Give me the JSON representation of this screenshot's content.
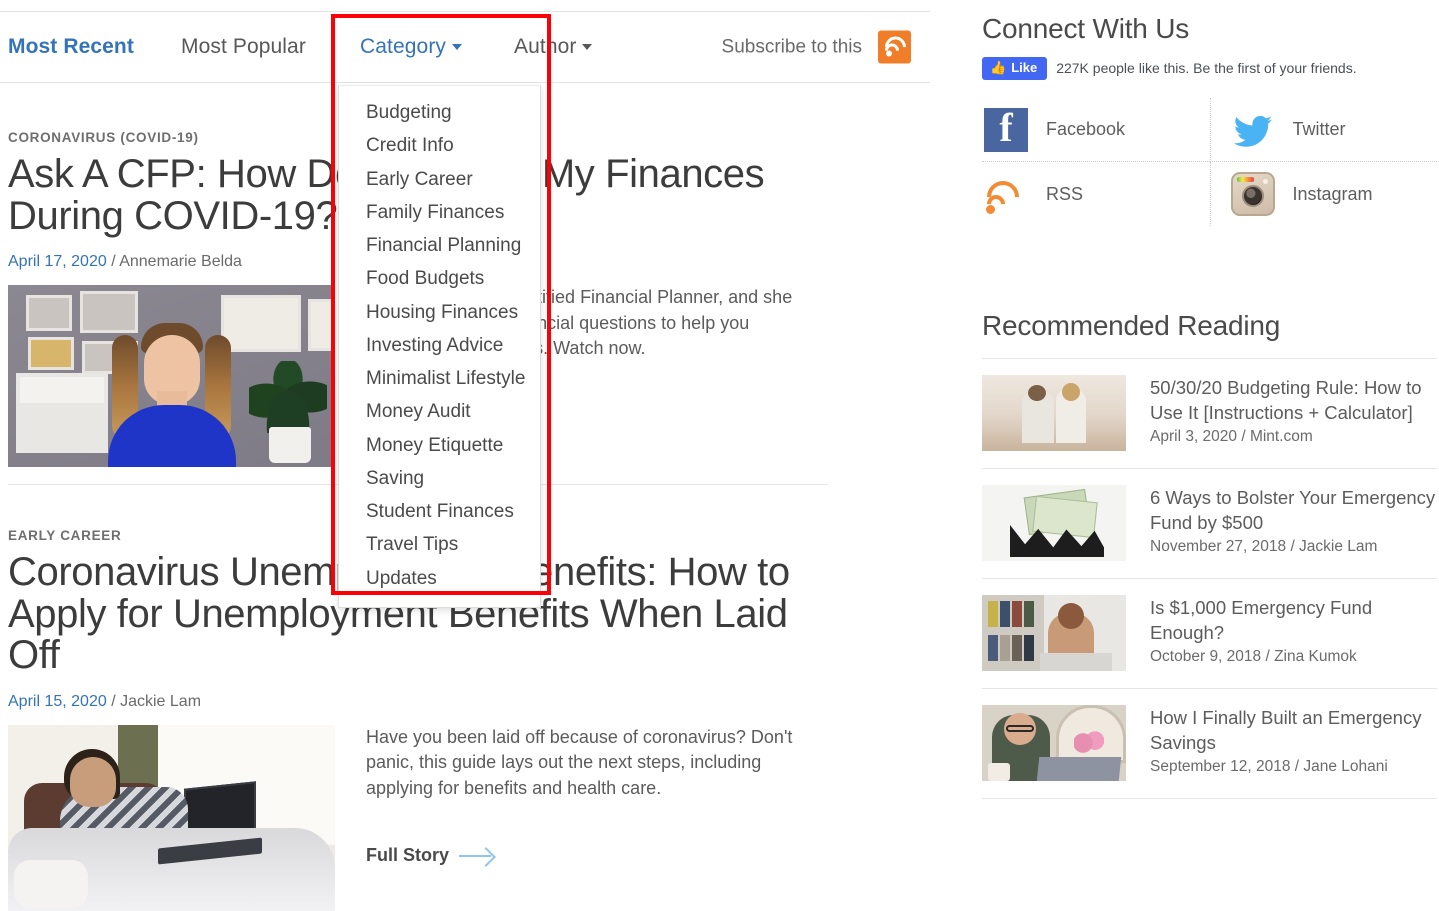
{
  "nav": {
    "items": [
      {
        "label": "Most Recent",
        "active": true,
        "has_caret": false
      },
      {
        "label": "Most Popular",
        "active": false,
        "has_caret": false
      },
      {
        "label": "Category",
        "active": false,
        "has_caret": true
      },
      {
        "label": "Author",
        "active": false,
        "has_caret": true
      }
    ],
    "subscribe_label": "Subscribe to this",
    "rss_icon": "rss-icon"
  },
  "category_dropdown": {
    "open": true,
    "items": [
      "Budgeting",
      "Credit Info",
      "Early Career",
      "Family Finances",
      "Financial Planning",
      "Food Budgets",
      "Housing Finances",
      "Investing Advice",
      "Minimalist Lifestyle",
      "Money Audit",
      "Money Etiquette",
      "Saving",
      "Student Finances",
      "Travel Tips",
      "Updates"
    ]
  },
  "annotation": {
    "shape": "rectangle",
    "color": "#fc0006"
  },
  "articles": [
    {
      "kicker": "CORONAVIRUS (COVID-19)",
      "headline": "Ask A CFP: How Do I Manage My Finances During COVID-19?",
      "date": "April 17, 2020",
      "separator": "/",
      "author": "Annemarie Belda",
      "excerpt": "Brittney Castro is Certified Financial Planner, and she answers your top financial questions to help you manage your finances. Watch now.",
      "image_alt": "Woman in blue top in home office with framed certificates"
    },
    {
      "kicker": "EARLY CAREER",
      "headline": "Coronavirus Unemployment Benefits: How to Apply for Unemployment Benefits When Laid Off",
      "date": "April 15, 2020",
      "separator": "/",
      "author": "Jackie Lam",
      "excerpt": "Have you been laid off because of coronavirus? Don't panic, this guide lays out the next steps, including applying for benefits and health care.",
      "cta": "Full Story",
      "image_alt": "Woman on bed using a laptop"
    }
  ],
  "sidebar": {
    "connect": {
      "title": "Connect With Us",
      "fb_like_label": "Like",
      "fb_like_count_text": "227K people like this. Be the first of your friends.",
      "social": [
        {
          "label": "Facebook",
          "icon": "facebook-icon"
        },
        {
          "label": "Twitter",
          "icon": "twitter-icon"
        },
        {
          "label": "RSS",
          "icon": "rss-icon"
        },
        {
          "label": "Instagram",
          "icon": "instagram-icon"
        }
      ]
    },
    "recommended": {
      "title": "Recommended Reading",
      "items": [
        {
          "headline": "50/30/20 Budgeting Rule: How to Use It [Instructions + Calculator]",
          "date": "April 3, 2020",
          "separator": "/",
          "author": "Mint.com",
          "meta": "April 3, 2020 / Mint.com",
          "image_alt": "Couple sitting on floor"
        },
        {
          "headline": "6 Ways to Bolster Your Emergency Fund by $500",
          "date": "November 27, 2018",
          "separator": "/",
          "author": "Jackie Lam",
          "meta": "November 27, 2018 / Jackie Lam",
          "image_alt": "Folded dollar bills casting a shadow"
        },
        {
          "headline": "Is $1,000 Emergency Fund Enough?",
          "date": "October 9, 2018",
          "separator": "/",
          "author": "Zina Kumok",
          "meta": "October 9, 2018 / Zina Kumok",
          "image_alt": "Woman at desk with laptop and bookshelf"
        },
        {
          "headline": "How I Finally Built an Emergency Savings",
          "date": "September 12, 2018",
          "separator": "/",
          "author": "Jane Lohani",
          "meta": "September 12, 2018 / Jane Lohani",
          "image_alt": "Woman with glasses looking at laptop"
        }
      ]
    }
  },
  "colors": {
    "link_blue": "#3573b9",
    "rss_orange": "#f07d28",
    "facebook_blue": "#4267f2",
    "twitter_blue": "#4ab3f4",
    "annotation_red": "#fc0006"
  }
}
